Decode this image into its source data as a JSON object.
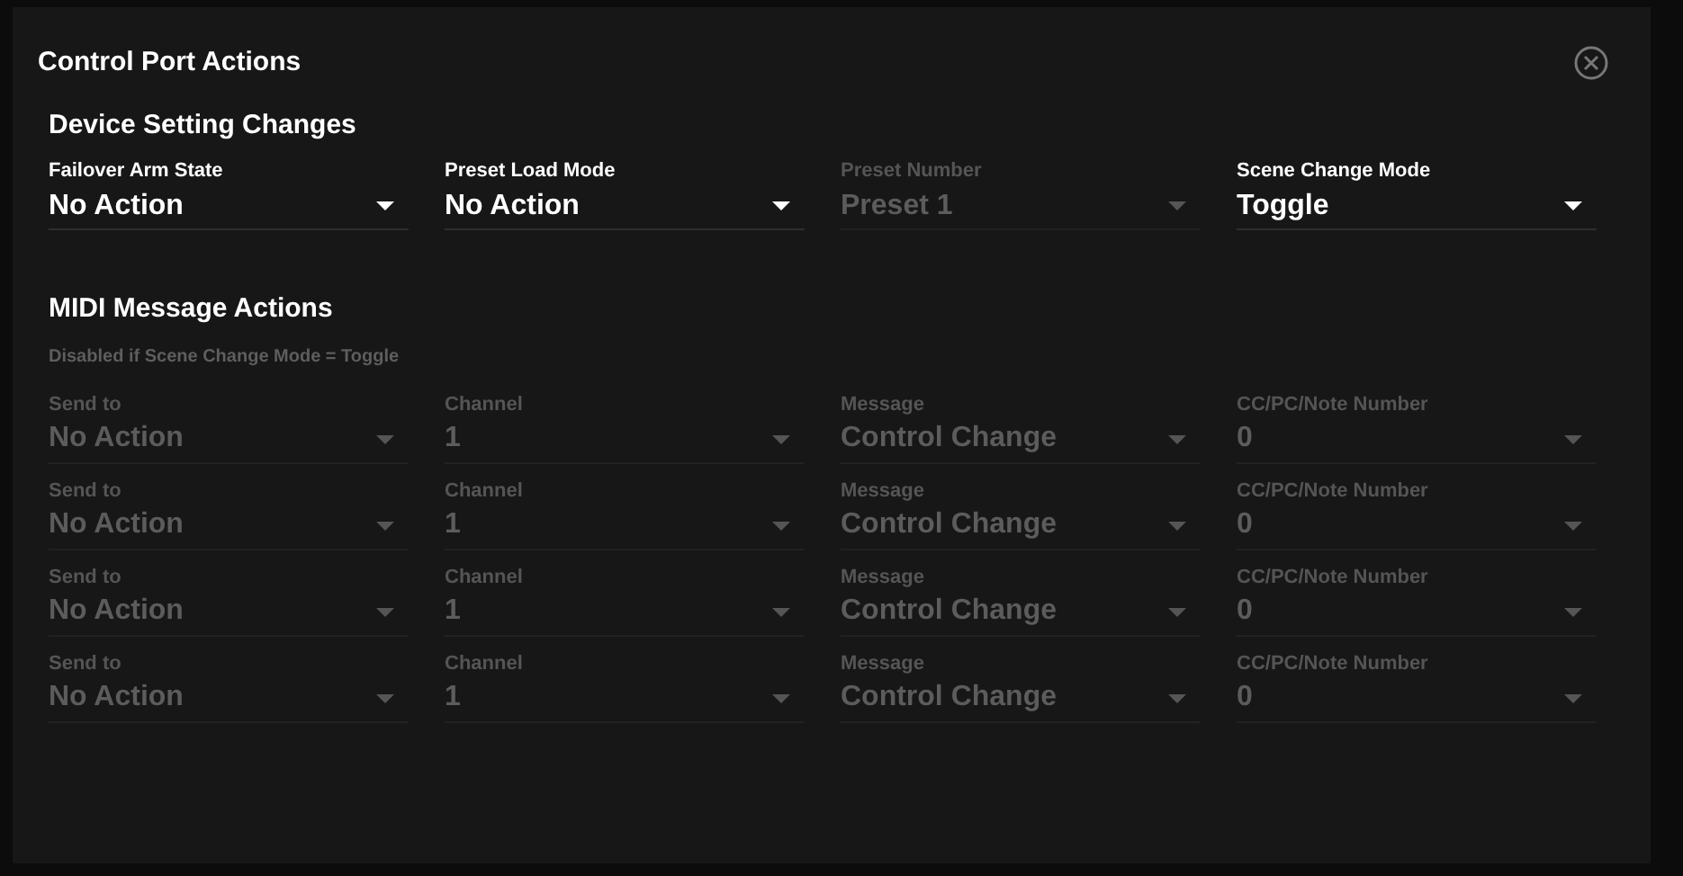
{
  "dialog": {
    "title": "Control Port Actions"
  },
  "device_settings": {
    "heading": "Device Setting Changes",
    "fields": [
      {
        "label": "Failover Arm State",
        "value": "No Action",
        "disabled": false
      },
      {
        "label": "Preset Load Mode",
        "value": "No Action",
        "disabled": false
      },
      {
        "label": "Preset Number",
        "value": "Preset 1",
        "disabled": true
      },
      {
        "label": "Scene Change Mode",
        "value": "Toggle",
        "disabled": false
      }
    ]
  },
  "midi_actions": {
    "heading": "MIDI Message Actions",
    "note": "Disabled if Scene Change Mode = Toggle",
    "rows": [
      {
        "fields": [
          {
            "label": "Send to",
            "value": "No Action",
            "disabled": true
          },
          {
            "label": "Channel",
            "value": "1",
            "disabled": true
          },
          {
            "label": "Message",
            "value": "Control Change",
            "disabled": true
          },
          {
            "label": "CC/PC/Note Number",
            "value": "0",
            "disabled": true
          }
        ]
      },
      {
        "fields": [
          {
            "label": "Send to",
            "value": "No Action",
            "disabled": true
          },
          {
            "label": "Channel",
            "value": "1",
            "disabled": true
          },
          {
            "label": "Message",
            "value": "Control Change",
            "disabled": true
          },
          {
            "label": "CC/PC/Note Number",
            "value": "0",
            "disabled": true
          }
        ]
      },
      {
        "fields": [
          {
            "label": "Send to",
            "value": "No Action",
            "disabled": true
          },
          {
            "label": "Channel",
            "value": "1",
            "disabled": true
          },
          {
            "label": "Message",
            "value": "Control Change",
            "disabled": true
          },
          {
            "label": "CC/PC/Note Number",
            "value": "0",
            "disabled": true
          }
        ]
      },
      {
        "fields": [
          {
            "label": "Send to",
            "value": "No Action",
            "disabled": true
          },
          {
            "label": "Channel",
            "value": "1",
            "disabled": true
          },
          {
            "label": "Message",
            "value": "Control Change",
            "disabled": true
          },
          {
            "label": "CC/PC/Note Number",
            "value": "0",
            "disabled": true
          }
        ]
      }
    ]
  }
}
